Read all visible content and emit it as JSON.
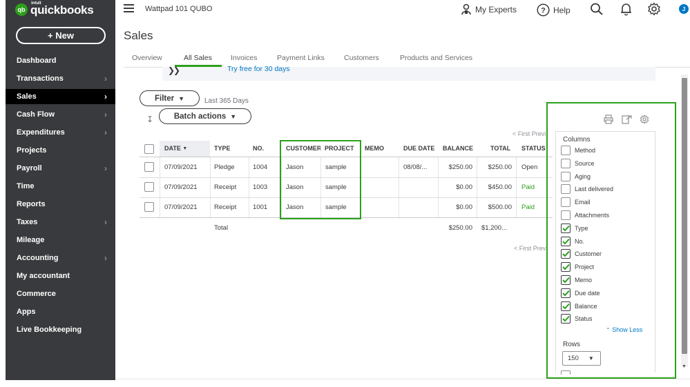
{
  "app": {
    "logo_mark": "qb",
    "brand": "quickbooks",
    "vendor": "intuit"
  },
  "header": {
    "company": "Wattpad 101 QUBO",
    "my_experts": "My Experts",
    "help": "Help",
    "avatar_initial": "J"
  },
  "sidebar": {
    "new_label": "+ New",
    "items": [
      {
        "label": "Dashboard",
        "chevron": false
      },
      {
        "label": "Transactions",
        "chevron": true
      },
      {
        "label": "Sales",
        "chevron": true,
        "active": true
      },
      {
        "label": "Cash Flow",
        "chevron": true
      },
      {
        "label": "Expenditures",
        "chevron": true
      },
      {
        "label": "Projects",
        "chevron": false
      },
      {
        "label": "Payroll",
        "chevron": true
      },
      {
        "label": "Time",
        "chevron": false
      },
      {
        "label": "Reports",
        "chevron": false
      },
      {
        "label": "Taxes",
        "chevron": true
      },
      {
        "label": "Mileage",
        "chevron": false
      },
      {
        "label": "Accounting",
        "chevron": true
      },
      {
        "label": "My accountant",
        "chevron": false
      },
      {
        "label": "Commerce",
        "chevron": false
      },
      {
        "label": "Apps",
        "chevron": false
      },
      {
        "label": "Live Bookkeeping",
        "chevron": false
      }
    ]
  },
  "page": {
    "title": "Sales",
    "tabs": [
      "Overview",
      "All Sales",
      "Invoices",
      "Payment Links",
      "Customers",
      "Products and Services"
    ],
    "active_tab": "All Sales",
    "promo_text": "Try free for 30 days"
  },
  "toolbar": {
    "filter_label": "Filter",
    "filter_range": "Last 365 Days",
    "batch_label": "Batch actions"
  },
  "pager": {
    "top": "< First  Previ",
    "bottom": "< First  Previ"
  },
  "table": {
    "headers": [
      "DATE",
      "TYPE",
      "NO.",
      "CUSTOMER",
      "PROJECT",
      "MEMO",
      "DUE DATE",
      "BALANCE",
      "TOTAL",
      "STATUS"
    ],
    "rows": [
      {
        "date": "07/09/2021",
        "type": "Pledge",
        "no": "1004",
        "customer": "Jason",
        "project": "sample",
        "memo": "",
        "due": "08/08/...",
        "balance": "$250.00",
        "total": "$250.00",
        "status": "Open"
      },
      {
        "date": "07/09/2021",
        "type": "Receipt",
        "no": "1003",
        "customer": "Jason",
        "project": "sample",
        "memo": "",
        "due": "",
        "balance": "$0.00",
        "total": "$450.00",
        "status": "Paid"
      },
      {
        "date": "07/09/2021",
        "type": "Receipt",
        "no": "1001",
        "customer": "Jason",
        "project": "sample",
        "memo": "",
        "due": "",
        "balance": "$0.00",
        "total": "$500.00",
        "status": "Paid"
      }
    ],
    "total_row": {
      "label": "Total",
      "balance": "$250.00",
      "total": "$1,200..."
    }
  },
  "settings_panel": {
    "columns_title": "Columns",
    "options": [
      {
        "label": "Method",
        "checked": false
      },
      {
        "label": "Source",
        "checked": false
      },
      {
        "label": "Aging",
        "checked": false
      },
      {
        "label": "Last delivered",
        "checked": false
      },
      {
        "label": "Email",
        "checked": false
      },
      {
        "label": "Attachments",
        "checked": false
      },
      {
        "label": "Type",
        "checked": true
      },
      {
        "label": "No.",
        "checked": true
      },
      {
        "label": "Customer",
        "checked": true
      },
      {
        "label": "Project",
        "checked": true
      },
      {
        "label": "Memo",
        "checked": true
      },
      {
        "label": "Due date",
        "checked": true
      },
      {
        "label": "Balance",
        "checked": true
      },
      {
        "label": "Status",
        "checked": true
      }
    ],
    "show_less": "Show Less",
    "rows_title": "Rows",
    "rows_value": "150"
  },
  "colors": {
    "brand_green": "#2ca01c",
    "sidebar_bg": "#393a3d",
    "link_blue": "#0077c5",
    "highlight": "#2ca01c"
  }
}
